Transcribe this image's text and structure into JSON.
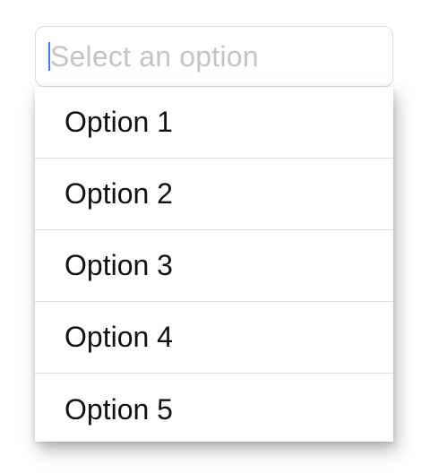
{
  "select": {
    "placeholder": "Select an option",
    "value": ""
  },
  "menu": {
    "options": [
      {
        "label": "Option 1"
      },
      {
        "label": "Option 2"
      },
      {
        "label": "Option 3"
      },
      {
        "label": "Option 4"
      },
      {
        "label": "Option 5"
      }
    ]
  },
  "colors": {
    "caret": "#3f7ee8",
    "placeholder": "#c4c4c8",
    "text": "#111111",
    "divider": "#dedede"
  }
}
